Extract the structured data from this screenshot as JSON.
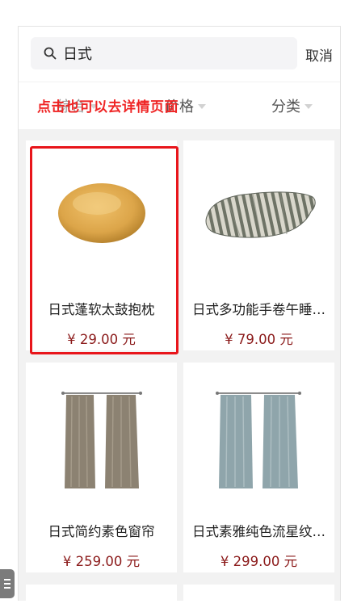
{
  "search": {
    "value": "日式",
    "cancel_label": "取消"
  },
  "filters": [
    {
      "label": "综合"
    },
    {
      "label": "价格"
    },
    {
      "label": "分类"
    }
  ],
  "annotation": "点击也可以去详情页面",
  "products": [
    {
      "name": "日式蓬软太鼓抱枕",
      "price": "¥ 29.00 元",
      "image_icon": "round-cushion-icon"
    },
    {
      "name": "日式多功能手卷午睡…",
      "price": "¥ 79.00 元",
      "image_icon": "striped-pillow-icon"
    },
    {
      "name": "日式简约素色窗帘",
      "price": "¥ 259.00 元",
      "image_icon": "beige-curtain-icon"
    },
    {
      "name": "日式素雅纯色流星纹…",
      "price": "¥ 299.00 元",
      "image_icon": "blue-curtain-icon"
    }
  ],
  "colors": {
    "annotation": "#ef2525",
    "highlight": "#e8151b",
    "price": "#8b1a1a",
    "background": "#f2f2f2"
  }
}
